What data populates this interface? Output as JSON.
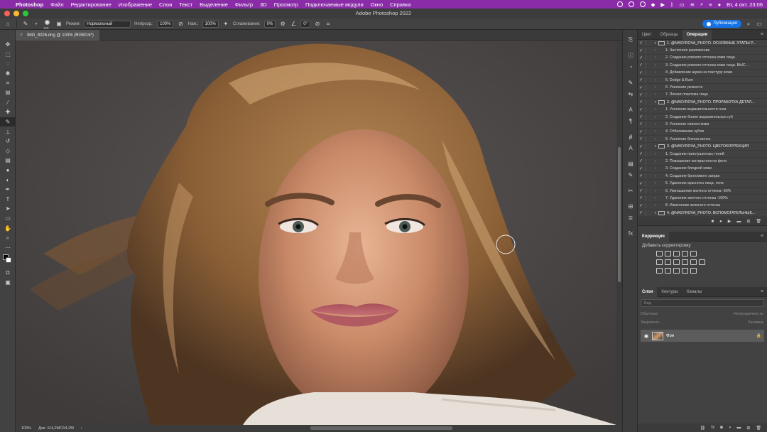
{
  "menubar": {
    "app_name": "Photoshop",
    "items": [
      "Файл",
      "Редактирование",
      "Изображение",
      "Слои",
      "Текст",
      "Выделение",
      "Фильтр",
      "3D",
      "Просмотр",
      "Подключаемые модули",
      "Окно",
      "Справка"
    ],
    "clock": "Вт, 4 окт. 23:06",
    "accent_color": "#8a2ca8"
  },
  "window": {
    "title": "Adobe Photoshop 2022"
  },
  "options": {
    "brush_size": "125",
    "mode_label": "Режим:",
    "mode_value": "Нормальный",
    "opacity_label": "Непрозр.:",
    "opacity_value": "100%",
    "pressure_label": "Наж.:",
    "pressure_value": "100%",
    "smoothing_label": "Сглаживание:",
    "smoothing_value": "0%",
    "angle_value": "0°",
    "publish_label": "Публикация",
    "publish_color": "#1473e6"
  },
  "document": {
    "tab_title": "IMG_8026.dng @ 100% (RGB/16*)",
    "zoom": "100%",
    "doc_info": "Док: 114,2M/114,2M"
  },
  "panel_top": {
    "tabs": [
      "Цвет",
      "Образцы",
      "Операции"
    ],
    "active_tab": "Операции"
  },
  "actions": [
    {
      "kind": "set",
      "text": "1. @NASYROVA_PHOTO. ОСНОВНЫЕ ЭТАПЫ Р..."
    },
    {
      "kind": "step",
      "text": "1. Частотное разложение"
    },
    {
      "kind": "step",
      "text": "2. Создание ровного оттенка кожи лица"
    },
    {
      "kind": "step",
      "text": "3. Создание ровного оттенка кожи лица. БЫС..."
    },
    {
      "kind": "step",
      "text": "4. Добавление шума на текстуру кожи"
    },
    {
      "kind": "step",
      "text": "5. Dodge & Burn"
    },
    {
      "kind": "step",
      "text": "6. Усиление резкости"
    },
    {
      "kind": "step",
      "text": "7. Легкая пластика лица"
    },
    {
      "kind": "set",
      "text": "2. @NASYROVA_PHOTO. ПРОРАБОТКА ДЕТАЛ..."
    },
    {
      "kind": "step",
      "text": "1. Усиление выразительности глаз"
    },
    {
      "kind": "step",
      "text": "2. Создание более выразительных губ"
    },
    {
      "kind": "step",
      "text": "3. Усиление сияния кожи"
    },
    {
      "kind": "step",
      "text": "4. Отбеливание зубов"
    },
    {
      "kind": "step",
      "text": "5. Усиление блеска волос"
    },
    {
      "kind": "set",
      "text": "3. @NASYROVA_PHOTO. ЦВЕТОКОРРЕКЦИЯ"
    },
    {
      "kind": "step",
      "text": "1. Создание приглушенных теней"
    },
    {
      "kind": "step",
      "text": "2. Повышение контрастности фото"
    },
    {
      "kind": "step",
      "text": "3. Создание бледной кожи"
    },
    {
      "kind": "step",
      "text": "4. Создание бронзового загара"
    },
    {
      "kind": "step",
      "text": "5. Удаление красноты лица, тела"
    },
    {
      "kind": "step",
      "text": "6. Уменьшение желтого оттенка -50%"
    },
    {
      "kind": "step",
      "text": "7. Удаление желтого оттенка -100%"
    },
    {
      "kind": "step",
      "text": "8. Изменение зеленого оттенка"
    },
    {
      "kind": "set",
      "text": "4. @NASYROVA_PHOTO. ВСПОМОГАТЕЛЬНЫЕ..."
    }
  ],
  "corrections": {
    "title": "Коррекция",
    "add_label": "Добавить корректировку"
  },
  "layers": {
    "tabs": [
      "Слои",
      "Контуры",
      "Каналы"
    ],
    "active_tab": "Слои",
    "search_placeholder": "Вид",
    "blend_mode": "Обычные",
    "opacity_label": "Непрозрачность:",
    "lock_label": "Закрепить:",
    "fill_label": "Заливка:",
    "layer_name": "Фон"
  }
}
